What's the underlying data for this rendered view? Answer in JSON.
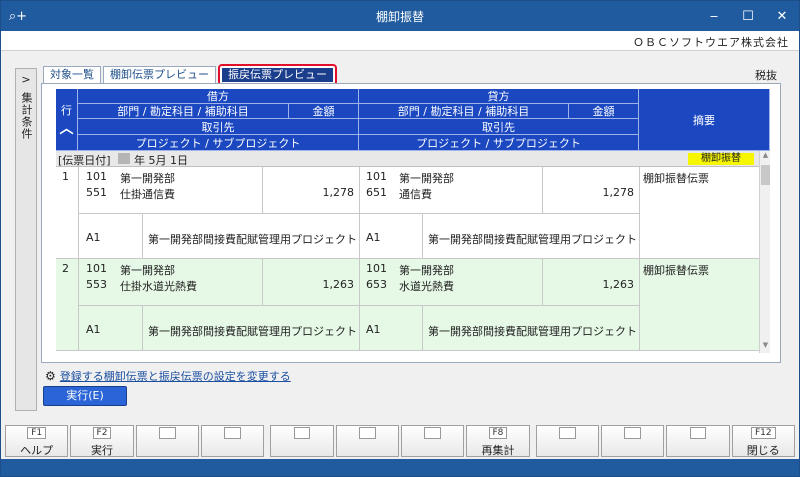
{
  "window": {
    "title": "棚卸振替",
    "app_icon": "search-plus-icon",
    "minimize": "‒",
    "maximize": "☐",
    "close": "✕"
  },
  "company": "ＯＢＣソフトウエア株式会社",
  "side_panel": {
    "chevron": ">",
    "label": "集計条件"
  },
  "tabs": [
    "対象一覧",
    "棚卸伝票プレビュー",
    "振戻伝票プレビュー"
  ],
  "tax_mode": "税抜",
  "grid": {
    "row_col": "行",
    "debit": "借方",
    "credit": "貸方",
    "dept_header": "部門 / 勘定科目 / 補助科目",
    "amount_header": "金額",
    "partner_header": "取引先",
    "project_header": "プロジェクト / サブプロジェクト",
    "memo_header": "摘要",
    "sort_icon": "︿"
  },
  "date_row": {
    "label": "[伝票日付]",
    "date": "年  5月  1日",
    "badge": "棚卸振替"
  },
  "entries": [
    {
      "no": "1",
      "d_dept_code": "101",
      "d_dept_name": "第一開発部",
      "d_acct_code": "551",
      "d_acct_name": "仕掛通信費",
      "d_amount": "1,278",
      "c_dept_code": "101",
      "c_dept_name": "第一開発部",
      "c_acct_code": "651",
      "c_acct_name": "通信費",
      "c_amount": "1,278",
      "memo": "棚卸振替伝票",
      "d_proj_code": "A1",
      "d_proj_name": "第一開発部間接費配賦管理用プロジェクト",
      "c_proj_code": "A1",
      "c_proj_name": "第一開発部間接費配賦管理用プロジェクト"
    },
    {
      "no": "2",
      "d_dept_code": "101",
      "d_dept_name": "第一開発部",
      "d_acct_code": "553",
      "d_acct_name": "仕掛水道光熱費",
      "d_amount": "1,263",
      "c_dept_code": "101",
      "c_dept_name": "第一開発部",
      "c_acct_code": "653",
      "c_acct_name": "水道光熱費",
      "c_amount": "1,263",
      "memo": "棚卸振替伝票",
      "d_proj_code": "A1",
      "d_proj_name": "第一開発部間接費配賦管理用プロジェクト",
      "c_proj_code": "A1",
      "c_proj_name": "第一開発部間接費配賦管理用プロジェクト"
    }
  ],
  "settings_link": "登録する棚卸伝票と振戻伝票の設定を変更する",
  "run_button": "実行(E)",
  "fkeys": [
    {
      "key": "F1",
      "label": "ヘルプ"
    },
    {
      "key": "F2",
      "label": "実行"
    },
    {
      "key": "",
      "label": ""
    },
    {
      "key": "",
      "label": ""
    },
    {
      "key": "",
      "label": ""
    },
    {
      "key": "",
      "label": ""
    },
    {
      "key": "",
      "label": ""
    },
    {
      "key": "F8",
      "label": "再集計"
    },
    {
      "key": "",
      "label": ""
    },
    {
      "key": "",
      "label": ""
    },
    {
      "key": "",
      "label": ""
    },
    {
      "key": "F12",
      "label": "閉じる"
    }
  ]
}
